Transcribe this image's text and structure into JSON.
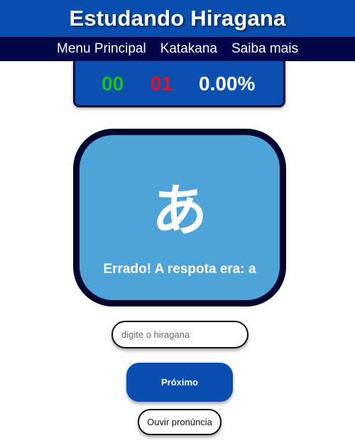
{
  "header": {
    "title": "Estudando Hiragana"
  },
  "nav": {
    "items": [
      {
        "label": "Menu Principal"
      },
      {
        "label": "Katakana"
      },
      {
        "label": "Saiba mais"
      }
    ]
  },
  "scoreboard": {
    "correct": "00",
    "wrong": "01",
    "percent": "0.00%"
  },
  "card": {
    "kana": "あ",
    "feedback": "Errado! A respota era: a"
  },
  "answer_input": {
    "value": "",
    "placeholder": "digite o hiragana"
  },
  "buttons": {
    "next_label": "Próximo",
    "listen_label": "Ouvir pronúncia"
  },
  "colors": {
    "header_blue": "#0a4fb0",
    "nav_navy": "#02064a",
    "card_blue": "#4ea3d8",
    "correct_green": "#16c216",
    "wrong_red": "#e0102a"
  }
}
